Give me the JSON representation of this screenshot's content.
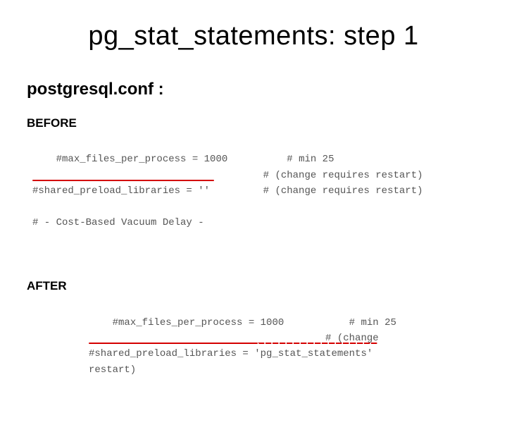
{
  "title": "pg_stat_statements: step 1",
  "subtitle": "postgresql.conf :",
  "before": {
    "label": "BEFORE",
    "code": "#max_files_per_process = 1000          # min 25\n                                       # (change requires restart)\n#shared_preload_libraries = ''         # (change requires restart)\n\n# - Cost-Based Vacuum Delay -"
  },
  "after": {
    "label": "AFTER",
    "code": "#max_files_per_process = 1000           # min 25\n                                        # (change\n#shared_preload_libraries = 'pg_stat_statements'\nrestart)"
  }
}
